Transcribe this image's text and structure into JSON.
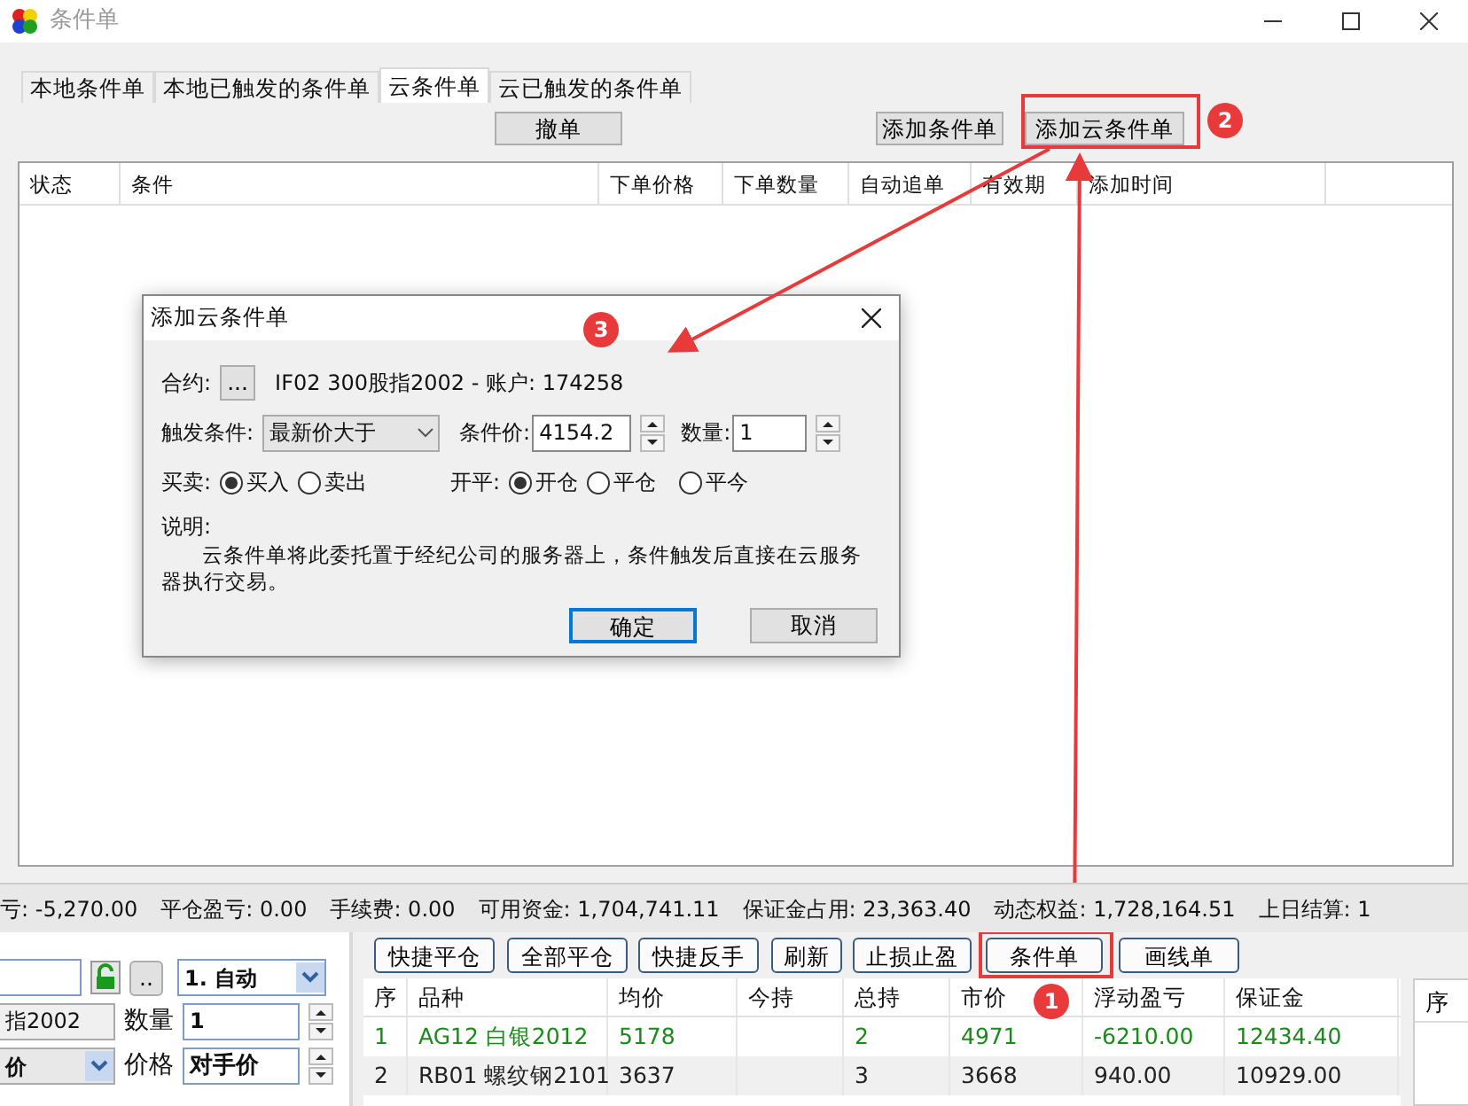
{
  "window": {
    "title": "条件单"
  },
  "tabs": [
    {
      "label": "本地条件单",
      "selected": false
    },
    {
      "label": "本地已触发的条件单",
      "selected": false
    },
    {
      "label": "云条件单",
      "selected": true
    },
    {
      "label": "云已触发的条件单",
      "selected": false
    }
  ],
  "toolbar": {
    "cancel_button": "撤单",
    "add_button": "添加条件单",
    "add_cloud_button": "添加云条件单"
  },
  "order_table": {
    "columns": [
      "状态",
      "条件",
      "下单价格",
      "下单数量",
      "自动追单",
      "有效期",
      "添加时间"
    ]
  },
  "dialog": {
    "title": "添加云条件单",
    "contract_label": "合约:",
    "contract_button": "...",
    "contract_text": "IF02 300股指2002 - 账户: 174258",
    "trigger_label": "触发条件:",
    "trigger_value": "最新价大于",
    "price_label": "条件价:",
    "price_value": "4154.2",
    "qty_label": "数量:",
    "qty_value": "1",
    "side_label": "买卖:",
    "side_options": [
      {
        "label": "买入",
        "selected": true
      },
      {
        "label": "卖出",
        "selected": false
      }
    ],
    "offset_label": "开平:",
    "offset_options": [
      {
        "label": "开仓",
        "selected": true
      },
      {
        "label": "平仓",
        "selected": false
      },
      {
        "label": "平今",
        "selected": false
      }
    ],
    "note_label": "说明:",
    "note_text": "云条件单将此委托置于经纪公司的服务器上，条件触发后直接在云服务器执行交易。",
    "ok_button": "确定",
    "cancel_button": "取消"
  },
  "status_bar": [
    "亏: -5,270.00",
    "平仓盈亏: 0.00",
    "手续费: 0.00",
    "可用资金: 1,704,741.11",
    "保证金占用: 23,363.40",
    "动态权益: 1,728,164.51",
    "上日结算: 1"
  ],
  "order_panel": {
    "mode_value": "1. 自动",
    "contract_value": "指2002",
    "qty_label": "数量",
    "qty_value": "1",
    "price_type_value": "价",
    "price_label": "价格",
    "price_value": "对手价",
    "more_button": ".."
  },
  "position_toolbar": [
    "快捷平仓",
    "全部平仓",
    "快捷反手",
    "刷新",
    "止损止盈",
    "条件单",
    "画线单"
  ],
  "positions": {
    "columns": [
      "序",
      "品种",
      "均价",
      "今持",
      "总持",
      "市价",
      "浮动盈亏",
      "保证金"
    ],
    "rows": [
      {
        "color": "#1a8a1a",
        "cells": [
          "1",
          "AG12 白银2012",
          "5178",
          "",
          "2",
          "4971",
          "-6210.00",
          "12434.40"
        ]
      },
      {
        "color": "#222222",
        "cells": [
          "2",
          "RB01 螺纹钢2101",
          "3637",
          "",
          "3",
          "3668",
          "940.00",
          "10929.00"
        ]
      }
    ]
  },
  "side_table": {
    "columns": [
      "序"
    ]
  },
  "annotations": [
    {
      "label": "1"
    },
    {
      "label": "2"
    },
    {
      "label": "3"
    }
  ]
}
